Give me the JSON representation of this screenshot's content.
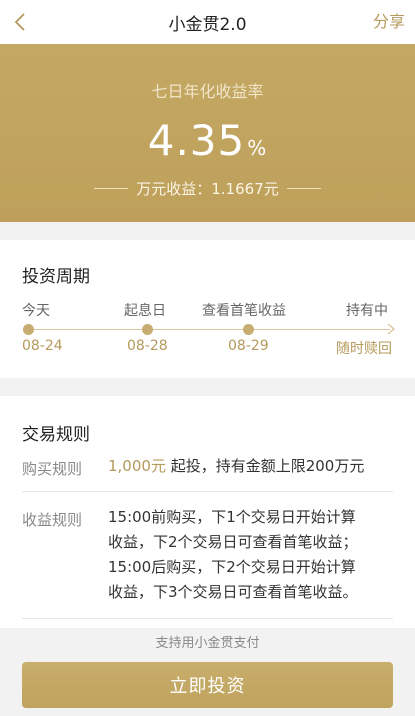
{
  "nav": {
    "title": "小金贯2.0",
    "share": "分享",
    "back_icon": "chevron-left-icon"
  },
  "hero": {
    "label": "七日年化收益率",
    "rate_value": "4.35",
    "rate_unit": "%",
    "wan_text": "万元收益：1.1667元"
  },
  "cycle": {
    "heading": "投资周期",
    "steps": [
      {
        "label": "今天",
        "date": "08-24"
      },
      {
        "label": "起息日",
        "date": "08-28"
      },
      {
        "label": "查看首笔收益",
        "date": "08-29"
      },
      {
        "label": "持有中",
        "date": "随时赎回"
      }
    ]
  },
  "rules": {
    "heading": "交易规则",
    "buy_label": "购买规则",
    "buy_amount": "1,000元",
    "buy_rest": " 起投，持有金额上限200万元",
    "income_label": "收益规则",
    "income_lines": [
      "15:00前购买，下1个交易日开始计算",
      "收益，下2个交易日可查看首笔收益；",
      "15:00后购买，下2个交易日开始计算",
      "收益，下3个交易日可查看首笔收益。"
    ]
  },
  "footer": {
    "support_text": "支持用小金贯支付",
    "invest_button": "立即投资"
  },
  "colors": {
    "gold": "#b59a5c",
    "hero_bg": "#c1a560"
  }
}
